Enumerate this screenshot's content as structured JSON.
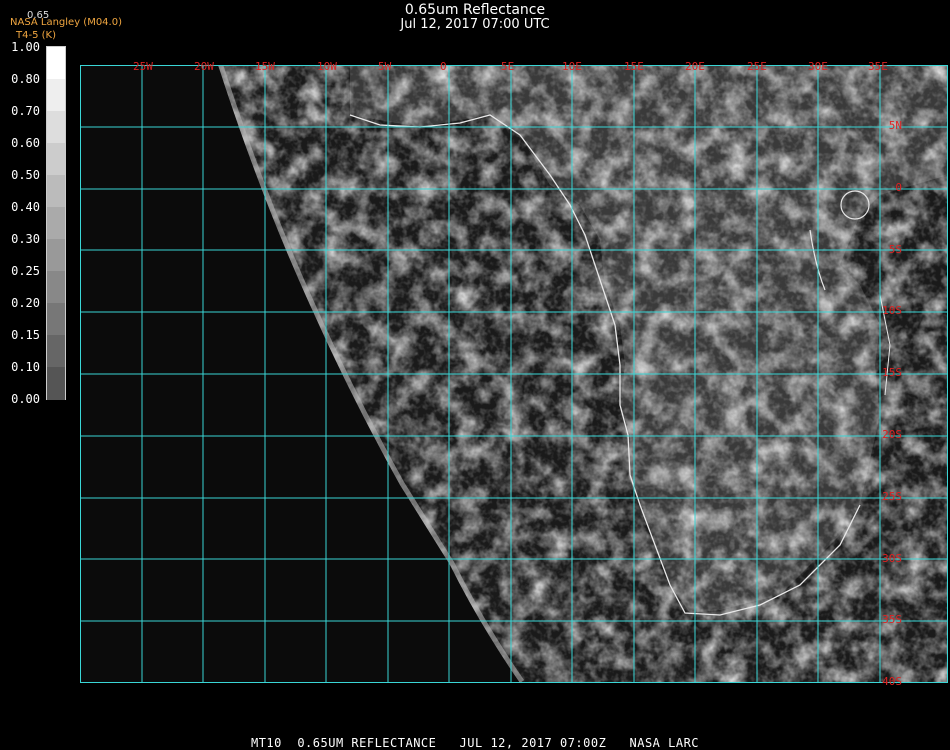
{
  "header": {
    "title": "0.65um Reflectance",
    "timestamp": "Jul 12, 2017 07:00 UTC",
    "credit": "NASA Langley (M04.0)",
    "secondary": "T4-5 (K)",
    "channel_value": "0.65"
  },
  "colorbar": {
    "ticks": [
      "1.00",
      "0.80",
      "0.70",
      "0.60",
      "0.50",
      "0.40",
      "0.30",
      "0.25",
      "0.20",
      "0.15",
      "0.10",
      "0.00"
    ],
    "colors": [
      "#ffffff",
      "#eeeeee",
      "#dddddd",
      "#cccccc",
      "#bbbbbb",
      "#aaaaaa",
      "#999999",
      "#888888",
      "#777777",
      "#666666",
      "#555555",
      "#111111"
    ]
  },
  "map": {
    "grid_color": "#3ad6d6",
    "label_color": "#dd2222",
    "lon_labels": [
      "25W",
      "20W",
      "15W",
      "10W",
      "5W",
      "0",
      "5E",
      "10E",
      "15E",
      "20E",
      "25E",
      "30E",
      "35E"
    ],
    "lat_labels": [
      "5N",
      "0",
      "5S",
      "10S",
      "15S",
      "20S",
      "25S",
      "30S",
      "35S",
      "40S"
    ]
  },
  "footer": {
    "text": "MT10  0.65UM REFLECTANCE   JUL 12, 2017 07:00Z   NASA LARC"
  }
}
